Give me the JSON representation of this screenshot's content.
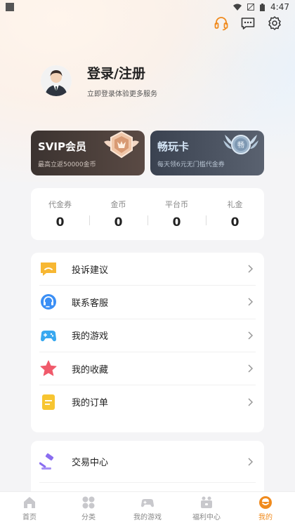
{
  "status": {
    "time": "4:47"
  },
  "header": {
    "icons": [
      "headset-icon",
      "message-icon",
      "settings-icon"
    ]
  },
  "profile": {
    "title": "登录/注册",
    "subtitle": "立即登录体验更多服务"
  },
  "cards": [
    {
      "title": "SVIP会员",
      "subtitle": "最高立返50000金币"
    },
    {
      "title": "畅玩卡",
      "subtitle": "每天领6元无门槛代金券",
      "badge": "畅"
    }
  ],
  "stats": [
    {
      "label": "代金券",
      "value": "0"
    },
    {
      "label": "金币",
      "value": "0"
    },
    {
      "label": "平台币",
      "value": "0"
    },
    {
      "label": "礼金",
      "value": "0"
    }
  ],
  "menu1": [
    {
      "label": "投诉建议",
      "icon": "complaint-icon"
    },
    {
      "label": "联系客服",
      "icon": "customer-service-icon"
    },
    {
      "label": "我的游戏",
      "icon": "gamepad-icon"
    },
    {
      "label": "我的收藏",
      "icon": "star-icon"
    },
    {
      "label": "我的订单",
      "icon": "order-icon"
    }
  ],
  "menu2": [
    {
      "label": "交易中心",
      "icon": "gavel-icon"
    }
  ],
  "tabs": [
    {
      "label": "首页",
      "icon": "home-icon"
    },
    {
      "label": "分类",
      "icon": "category-icon"
    },
    {
      "label": "我的游戏",
      "icon": "gamepad-icon"
    },
    {
      "label": "福利中心",
      "icon": "gift-icon"
    },
    {
      "label": "我的",
      "icon": "profile-icon",
      "active": true
    }
  ],
  "colors": {
    "accent": "#f08a1c"
  }
}
